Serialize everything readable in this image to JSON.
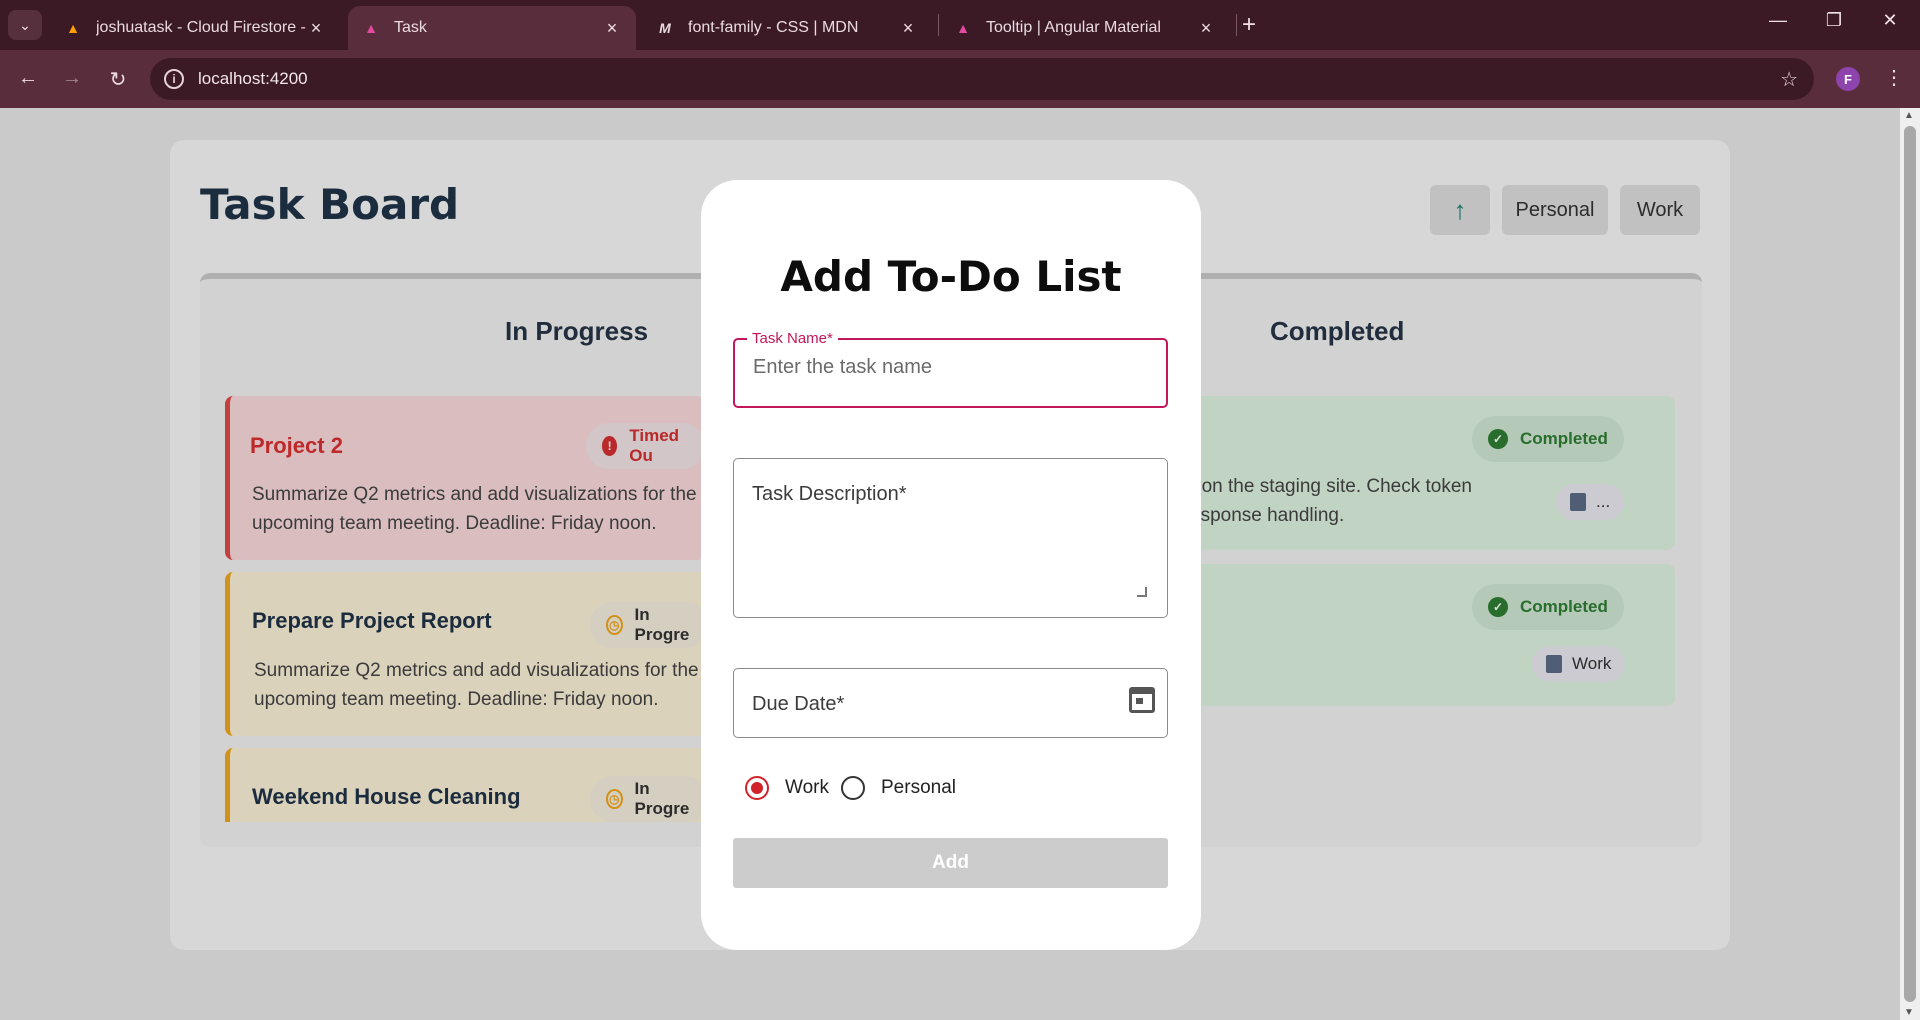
{
  "browser": {
    "tabs": [
      {
        "title": "joshuatask - Cloud Firestore - D",
        "icon": "firebase-icon"
      },
      {
        "title": "Task",
        "icon": "angular-icon",
        "active": true
      },
      {
        "title": "font-family - CSS | MDN",
        "icon": "mdn-icon"
      },
      {
        "title": "Tooltip | Angular Material",
        "icon": "angular-icon"
      }
    ],
    "url": "localhost:4200",
    "profile_initial": "F"
  },
  "board": {
    "title": "Task Board",
    "buttons": {
      "sort_icon": "arrow-up-icon",
      "personal": "Personal",
      "work": "Work"
    },
    "columns": {
      "in_progress": "In Progress",
      "completed": "Completed"
    },
    "in_progress_cards": [
      {
        "name": "Project 2",
        "status": "Timed Ou",
        "desc1": "Summarize Q2 metrics and add visualizations for the",
        "desc2": "upcoming team meeting. Deadline: Friday noon."
      },
      {
        "name": "Prepare Project Report",
        "status": "In Progre",
        "desc1": "Summarize Q2 metrics and add visualizations for the",
        "desc2": "upcoming team meeting. Deadline: Friday noon."
      },
      {
        "name": "Weekend House Cleaning",
        "status": "In Progre"
      }
    ],
    "completed_cards": [
      {
        "status": "Completed",
        "desc1": "r on the staging site. Check token",
        "desc2": "esponse handling.",
        "tag": "..."
      },
      {
        "status": "Completed",
        "tag": "Work"
      }
    ]
  },
  "modal": {
    "title": "Add To-Do List",
    "task_name_label": "Task Name*",
    "task_name_placeholder": "Enter the task name",
    "task_desc_label": "Task Description*",
    "due_date_label": "Due Date*",
    "radio_work": "Work",
    "radio_personal": "Personal",
    "selected": "Work",
    "add_button": "Add"
  },
  "colors": {
    "accent": "#c2185b",
    "radio": "#d0232a",
    "timed_out": "#d32f2f",
    "in_progress": "#f0a61d",
    "completed": "#2e7d32"
  }
}
